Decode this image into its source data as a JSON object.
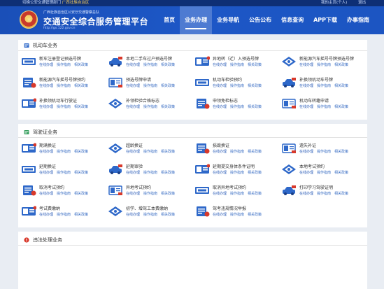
{
  "topbar": {
    "left_prefix": "切换公安交通管理部门",
    "left_region": "广西壮族自治区",
    "right_items": [
      "我的主页(个人)",
      "退出"
    ]
  },
  "header": {
    "org": "广西壮族自治区公安厅交通警察总队",
    "site_title": "交通安全综合服务管理平台",
    "url": "http://gx.122.gov.cn"
  },
  "nav": [
    "首页",
    "业务办理",
    "业务导航",
    "公告公布",
    "信息查询",
    "APP下载",
    "办事指南"
  ],
  "nav_active": 1,
  "links": [
    "在线办理",
    "操作指南",
    "相关政策"
  ],
  "sections": [
    {
      "title": "机动车业务",
      "items": [
        "新车注册登记预选号牌",
        "本地二手车过户预选号牌",
        "异地转（迁）入预选号牌",
        "新能源汽车摇号号牌预选号牌",
        "新能源汽车摇号号牌预约",
        "预选号牌申请",
        "机动车检验预约",
        "补换领机动车号牌",
        "补换领机动车行驶证",
        "补领检验合格标志",
        "申领免检标志",
        "机动车转籍申请"
      ]
    },
    {
      "title": "驾驶证业务",
      "items": [
        "期满换证",
        "超龄换证",
        "损毁换证",
        "遗失补证",
        "延期换证",
        "延期审验",
        "延期提交身体条件证明",
        "本地考试预约",
        "取消考试预约",
        "异地考试预约",
        "取消异地考试预约",
        "打印学习驾驶证明",
        "考试费缴纳",
        "初学、增驾工本费缴纳",
        "驾考违规情况举报"
      ]
    },
    {
      "title": "违法处理业务",
      "items": []
    }
  ],
  "colors": {
    "header_blue": "#1d57c6",
    "link_blue": "#3a6ec4",
    "icon_blue": "#2e68c9",
    "badge_red": "#d8392b"
  }
}
